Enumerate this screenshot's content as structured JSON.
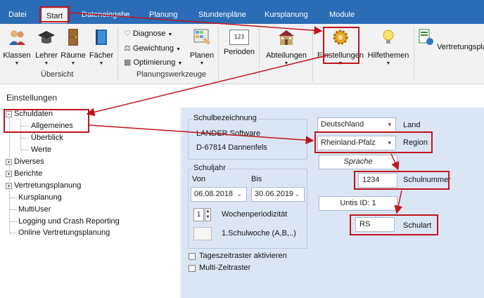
{
  "ribbon_tabs": [
    {
      "label": "Datei"
    },
    {
      "label": "Start"
    },
    {
      "label": "Dateneingabe"
    },
    {
      "label": "Planung"
    },
    {
      "label": "Stundenpläne"
    },
    {
      "label": "Kursplanung"
    },
    {
      "label": "Module"
    }
  ],
  "ribbon": {
    "klassen": "Klassen",
    "lehrer": "Lehrer",
    "raeume": "Räume",
    "faecher": "Fächer",
    "uebersicht_group": "Übersicht",
    "diagnose": "Diagnose",
    "gewichtung": "Gewichtung",
    "optimierung": "Optimierung",
    "planen": "Planen",
    "perioden": "Perioden",
    "perioden_icon_text": "123",
    "planungswerkzeuge_group": "Planungswerkzeuge",
    "abteilungen": "Abteilungen",
    "einstellungen": "Einstellungen",
    "hilfethemen": "Hilfethemen",
    "vertretungsplanung": "Vertretungsplanun"
  },
  "page_title": "Einstellungen",
  "tree": {
    "schuldaten": "Schuldaten",
    "allgemeines": "Allgemeines",
    "ueberblick": "Überblick",
    "werte": "Werte",
    "diverses": "Diverses",
    "berichte": "Berichte",
    "vertretungsplanung": "Vertretungsplanung",
    "kursplanung": "Kursplanung",
    "multiuser": "MultiUser",
    "logging": "Logging und Crash Reporting",
    "online_vertretungsplanung": "Online Vertretungsplanung"
  },
  "form": {
    "schulbezeichnung_label": "Schulbezeichnung",
    "school_name": "LANDER Software",
    "school_address": "D-67814 Dannenfels",
    "schuljahr_label": "Schuljahr",
    "von_label": "Von",
    "bis_label": "Bis",
    "von_value": "06.08.2018",
    "bis_value": "30.06.2019",
    "wochenperiodizitaet_value": "1",
    "wochenperiodizitaet_label": "Wochenperiodizität",
    "schulwoche_label": "1.Schulwoche (A,B,..)",
    "tageszeitraster_label": "Tageszeitraster aktivieren",
    "multizeitraster_label": "Multi-Zeitraster",
    "land_value": "Deutschland",
    "land_label": "Land",
    "region_value": "Rheinland-Pfalz",
    "region_label": "Region",
    "sprache_button": "Sprache",
    "schulnummer_value": "1234",
    "schulnummer_label": "Schulnummer",
    "untis_id": "Untis ID: 1",
    "schulart_value": "RS",
    "schulart_label": "Schulart"
  },
  "colors": {
    "tabbar": "#2b6cb6",
    "ribbon": "#f2f2f2",
    "panel": "#dbe6f5",
    "highlight": "#c0141b"
  }
}
